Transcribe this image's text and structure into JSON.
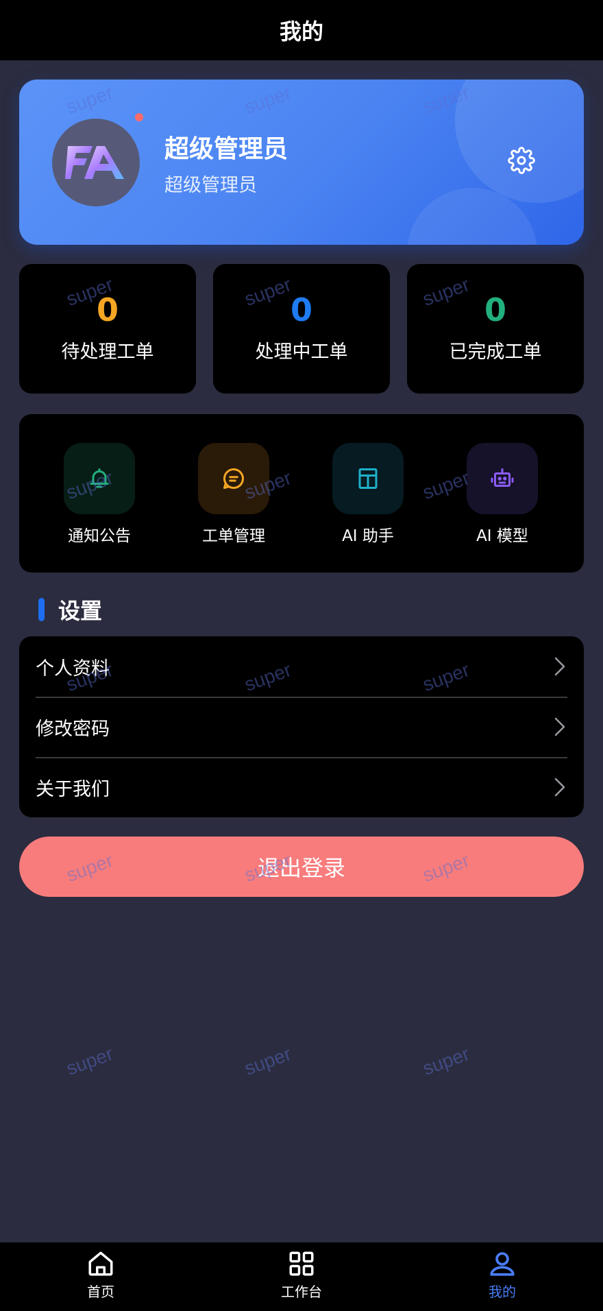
{
  "header": {
    "title": "我的"
  },
  "profile": {
    "name": "超级管理员",
    "role": "超级管理员",
    "avatar_text": "FA",
    "settings_icon": "gear-icon"
  },
  "stats": [
    {
      "value": "0",
      "label": "待处理工单",
      "color": "#f5a623"
    },
    {
      "value": "0",
      "label": "处理中工单",
      "color": "#1e7bf2"
    },
    {
      "value": "0",
      "label": "已完成工单",
      "color": "#22b07d"
    }
  ],
  "tools": [
    {
      "label": "通知公告",
      "icon": "bell-icon",
      "color": "#22b07d",
      "bg": "#071e17"
    },
    {
      "label": "工单管理",
      "icon": "chat-icon",
      "color": "#f5a623",
      "bg": "#2a1a08"
    },
    {
      "label": "AI 助手",
      "icon": "layout-icon",
      "color": "#1fb0c9",
      "bg": "#061b22"
    },
    {
      "label": "AI 模型",
      "icon": "robot-icon",
      "color": "#8b5cf6",
      "bg": "#16122a"
    }
  ],
  "settings_section": {
    "title": "设置",
    "items": [
      {
        "label": "个人资料"
      },
      {
        "label": "修改密码"
      },
      {
        "label": "关于我们"
      }
    ]
  },
  "logout": {
    "label": "退出登录"
  },
  "tabbar": {
    "items": [
      {
        "label": "首页",
        "icon": "home-icon",
        "active": false
      },
      {
        "label": "工作台",
        "icon": "grid-icon",
        "active": false
      },
      {
        "label": "我的",
        "icon": "user-icon",
        "active": true
      }
    ],
    "active_color": "#4a7cf6"
  },
  "watermark": {
    "text": "super"
  }
}
